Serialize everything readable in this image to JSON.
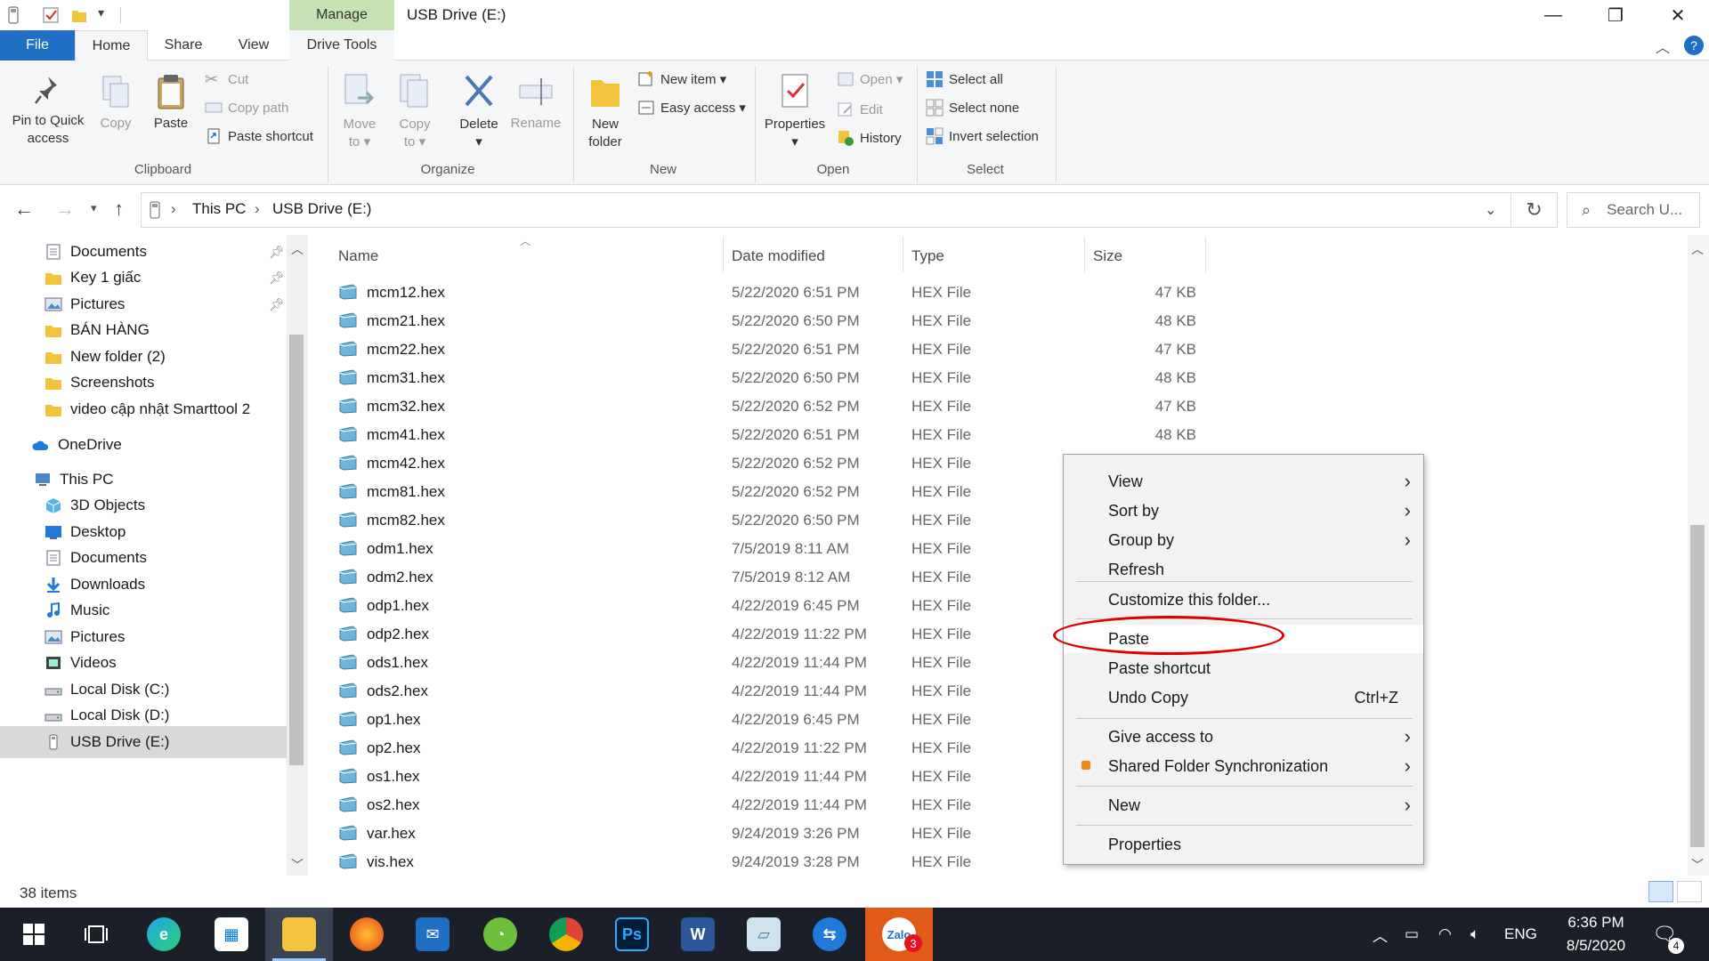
{
  "window": {
    "title": "USB Drive (E:)",
    "manage_tab": "Manage",
    "minimize": "—",
    "maximize": "❐",
    "close": "✕"
  },
  "ribbon_tabs": {
    "file": "File",
    "home": "Home",
    "share": "Share",
    "view": "View",
    "drive_tools": "Drive Tools"
  },
  "ribbon": {
    "clipboard": {
      "label": "Clipboard",
      "pin": "Pin to Quick\naccess",
      "copy": "Copy",
      "paste": "Paste",
      "cut": "Cut",
      "copy_path": "Copy path",
      "paste_shortcut": "Paste shortcut"
    },
    "organize": {
      "label": "Organize",
      "move_to": "Move\nto ▾",
      "copy_to": "Copy\nto ▾",
      "delete": "Delete\n▾",
      "rename": "Rename"
    },
    "new": {
      "label": "New",
      "new_folder": "New\nfolder",
      "new_item": "New item ▾",
      "easy_access": "Easy access ▾"
    },
    "open": {
      "label": "Open",
      "properties": "Properties\n▾",
      "open": "Open ▾",
      "edit": "Edit",
      "history": "History"
    },
    "select": {
      "label": "Select",
      "select_all": "Select all",
      "select_none": "Select none",
      "invert": "Invert selection"
    }
  },
  "address": {
    "crumbs": [
      "This PC",
      "USB Drive (E:)"
    ],
    "search_placeholder": "Search U..."
  },
  "nav": [
    {
      "label": "Documents",
      "icon": "doc",
      "pinned": true
    },
    {
      "label": "Key 1 giấc",
      "icon": "folder",
      "pinned": true
    },
    {
      "label": "Pictures",
      "icon": "pictures",
      "pinned": true
    },
    {
      "label": "BÁN HÀNG",
      "icon": "folder",
      "pinned": false
    },
    {
      "label": "New folder (2)",
      "icon": "folder",
      "pinned": false
    },
    {
      "label": "Screenshots",
      "icon": "folder",
      "pinned": false
    },
    {
      "label": "video cập nhật Smarttool 2",
      "icon": "folder",
      "pinned": false
    },
    {
      "label": "OneDrive",
      "icon": "cloud",
      "pinned": false
    },
    {
      "label": "This PC",
      "icon": "pc",
      "pinned": false
    },
    {
      "label": "3D Objects",
      "icon": "cube",
      "pinned": false
    },
    {
      "label": "Desktop",
      "icon": "desktop",
      "pinned": false
    },
    {
      "label": "Documents",
      "icon": "doc",
      "pinned": false
    },
    {
      "label": "Downloads",
      "icon": "download",
      "pinned": false
    },
    {
      "label": "Music",
      "icon": "music",
      "pinned": false
    },
    {
      "label": "Pictures",
      "icon": "pictures",
      "pinned": false
    },
    {
      "label": "Videos",
      "icon": "video",
      "pinned": false
    },
    {
      "label": "Local Disk (C:)",
      "icon": "disk",
      "pinned": false
    },
    {
      "label": "Local Disk (D:)",
      "icon": "disk",
      "pinned": false
    },
    {
      "label": "USB Drive (E:)",
      "icon": "usb",
      "pinned": false,
      "selected": true
    }
  ],
  "columns": {
    "name": "Name",
    "date": "Date modified",
    "type": "Type",
    "size": "Size"
  },
  "files": [
    {
      "name": "mcm12.hex",
      "date": "5/22/2020 6:51 PM",
      "type": "HEX File",
      "size": "47 KB"
    },
    {
      "name": "mcm21.hex",
      "date": "5/22/2020 6:50 PM",
      "type": "HEX File",
      "size": "48 KB"
    },
    {
      "name": "mcm22.hex",
      "date": "5/22/2020 6:51 PM",
      "type": "HEX File",
      "size": "47 KB"
    },
    {
      "name": "mcm31.hex",
      "date": "5/22/2020 6:50 PM",
      "type": "HEX File",
      "size": "48 KB"
    },
    {
      "name": "mcm32.hex",
      "date": "5/22/2020 6:52 PM",
      "type": "HEX File",
      "size": "47 KB"
    },
    {
      "name": "mcm41.hex",
      "date": "5/22/2020 6:51 PM",
      "type": "HEX File",
      "size": "48 KB"
    },
    {
      "name": "mcm42.hex",
      "date": "5/22/2020 6:52 PM",
      "type": "HEX File",
      "size": ""
    },
    {
      "name": "mcm81.hex",
      "date": "5/22/2020 6:52 PM",
      "type": "HEX File",
      "size": ""
    },
    {
      "name": "mcm82.hex",
      "date": "5/22/2020 6:50 PM",
      "type": "HEX File",
      "size": ""
    },
    {
      "name": "odm1.hex",
      "date": "7/5/2019 8:11 AM",
      "type": "HEX File",
      "size": ""
    },
    {
      "name": "odm2.hex",
      "date": "7/5/2019 8:12 AM",
      "type": "HEX File",
      "size": ""
    },
    {
      "name": "odp1.hex",
      "date": "4/22/2019 6:45 PM",
      "type": "HEX File",
      "size": ""
    },
    {
      "name": "odp2.hex",
      "date": "4/22/2019 11:22 PM",
      "type": "HEX File",
      "size": ""
    },
    {
      "name": "ods1.hex",
      "date": "4/22/2019 11:44 PM",
      "type": "HEX File",
      "size": ""
    },
    {
      "name": "ods2.hex",
      "date": "4/22/2019 11:44 PM",
      "type": "HEX File",
      "size": ""
    },
    {
      "name": "op1.hex",
      "date": "4/22/2019 6:45 PM",
      "type": "HEX File",
      "size": ""
    },
    {
      "name": "op2.hex",
      "date": "4/22/2019 11:22 PM",
      "type": "HEX File",
      "size": ""
    },
    {
      "name": "os1.hex",
      "date": "4/22/2019 11:44 PM",
      "type": "HEX File",
      "size": ""
    },
    {
      "name": "os2.hex",
      "date": "4/22/2019 11:44 PM",
      "type": "HEX File",
      "size": ""
    },
    {
      "name": "var.hex",
      "date": "9/24/2019 3:26 PM",
      "type": "HEX File",
      "size": ""
    },
    {
      "name": "vis.hex",
      "date": "9/24/2019 3:28 PM",
      "type": "HEX File",
      "size": ""
    }
  ],
  "status": {
    "items": "38 items"
  },
  "context_menu": {
    "view": "View",
    "sort_by": "Sort by",
    "group_by": "Group by",
    "refresh": "Refresh",
    "customize": "Customize this folder...",
    "paste": "Paste",
    "paste_shortcut": "Paste shortcut",
    "undo_copy": "Undo Copy",
    "undo_shortcut": "Ctrl+Z",
    "give_access": "Give access to",
    "shared_sync": "Shared Folder Synchronization",
    "new": "New",
    "properties": "Properties"
  },
  "taskbar": {
    "language": "ENG",
    "time": "6:36 PM",
    "date": "8/5/2020",
    "notification_count": "4",
    "zalo_badge": "3",
    "ps_label": "Ps",
    "word_label": "W"
  },
  "colors": {
    "file_tab": "#1f6fc5",
    "manage_tab": "#c7e3b6",
    "highlight_oval": "#e00000",
    "taskbar": "#1b2028"
  }
}
